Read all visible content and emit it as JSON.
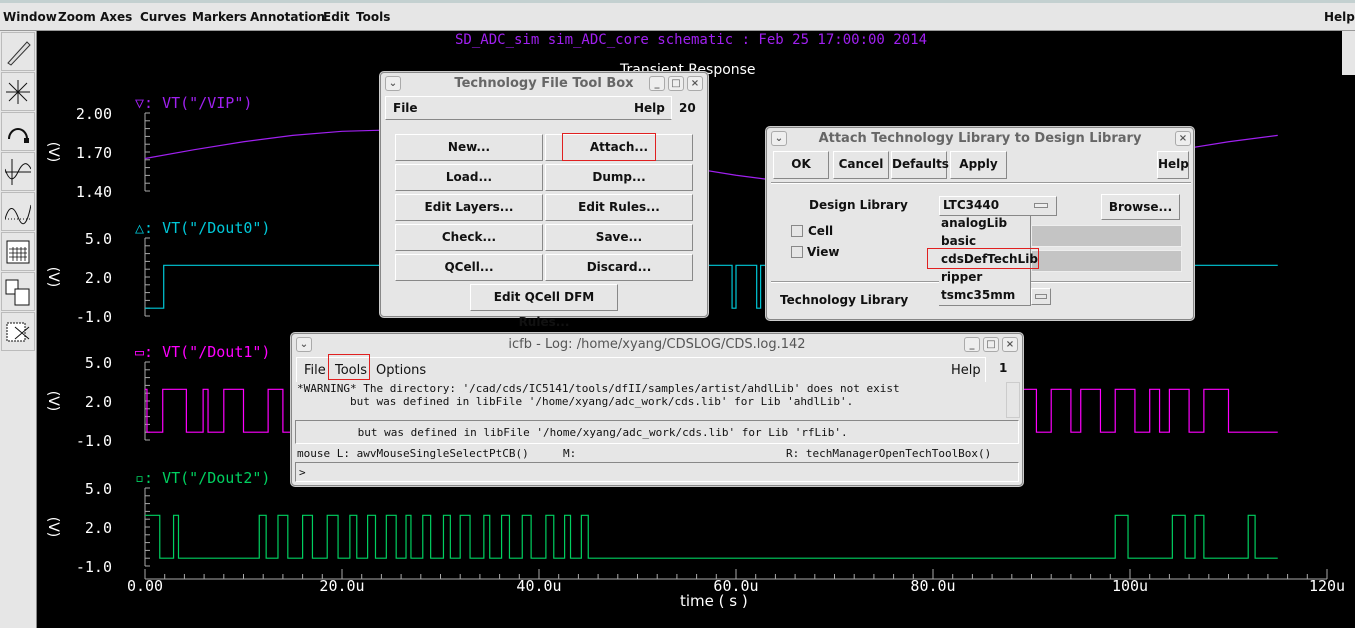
{
  "menubar": {
    "items": [
      "Window",
      "Zoom",
      "Axes",
      "Curves",
      "Markers",
      "Annotation",
      "Edit",
      "Tools"
    ],
    "help": "Help"
  },
  "toolbar": {
    "icons": [
      "pencil-icon",
      "zoom-fit-icon",
      "undo-arc-icon",
      "ab-marker-icon",
      "delta-marker-icon",
      "calculator-icon",
      "strip-icon",
      "cut-icon"
    ]
  },
  "plot": {
    "header": "SD_ADC_sim sim_ADC_core schematic : Feb 25 17:00:00 2014",
    "title": "Transient Response",
    "xlabel": "time ( s )",
    "ylabel": "(V)"
  },
  "chart_data": {
    "type": "line",
    "title": "Transient Response",
    "xlabel": "time ( s )",
    "xticks": [
      "0.00",
      "20.0u",
      "40.0u",
      "60.0u",
      "80.0u",
      "100u",
      "120u"
    ],
    "xlim": [
      0,
      120
    ],
    "strips": [
      {
        "name": "▽: VT(\"/VIP\")",
        "color": "#a020f0",
        "ylim": [
          1.4,
          2.0
        ],
        "yticks": [
          "2.00",
          "1.70",
          "1.40"
        ],
        "kind": "analog",
        "x": [
          0,
          5,
          10,
          15,
          20,
          25,
          30,
          35,
          40,
          45,
          50,
          55,
          60,
          65,
          70,
          75,
          80,
          85,
          90,
          95,
          100,
          105,
          110,
          115
        ],
        "y": [
          1.65,
          1.718,
          1.779,
          1.828,
          1.859,
          1.87,
          1.859,
          1.828,
          1.779,
          1.718,
          1.65,
          1.582,
          1.521,
          1.472,
          1.441,
          1.43,
          1.441,
          1.472,
          1.521,
          1.582,
          1.65,
          1.718,
          1.779,
          1.828
        ]
      },
      {
        "name": "△: VT(\"/Dout0\")",
        "color": "#00c8d8",
        "ylim": [
          -1,
          5
        ],
        "yticks": [
          "5.0",
          "2.0",
          "-1.0"
        ],
        "kind": "digital",
        "high": 2.9,
        "low": -0.4,
        "start": "low",
        "end": 115,
        "toggles": [
          1.9,
          59.6,
          60.0,
          62.1,
          62.5,
          64.8,
          65.2
        ]
      },
      {
        "name": "▭: VT(\"/Dout1\")",
        "color": "#ff00ff",
        "ylim": [
          -1,
          5
        ],
        "yticks": [
          "5.0",
          "2.0",
          "-1.0"
        ],
        "kind": "digital",
        "high": 2.9,
        "low": -0.4,
        "start": "high",
        "end": 115,
        "toggles": [
          0.2,
          1.8,
          4.2,
          5.9,
          6.4,
          8.0,
          10.0,
          12.5,
          14.0,
          16.0,
          17.5,
          19.5,
          21.0,
          24.0,
          25.5,
          28.0,
          29.0,
          31.0,
          33.0,
          36.0,
          37.5,
          40.0,
          42.0,
          44.0,
          46.0,
          49.0,
          51,
          53,
          55,
          58,
          60,
          62,
          64,
          67,
          69,
          71,
          73,
          76,
          78,
          80,
          82,
          85,
          87,
          89,
          90.5,
          92,
          94,
          95,
          97,
          98.5,
          100.5,
          102,
          103,
          104,
          106,
          107.5,
          110
        ]
      },
      {
        "name": "▫: VT(\"/Dout2\")",
        "color": "#00d060",
        "ylim": [
          -1,
          5
        ],
        "yticks": [
          "5.0",
          "2.0",
          "-1.0"
        ],
        "kind": "digital",
        "high": 2.9,
        "low": -0.4,
        "start": "high",
        "end": 115,
        "toggles": [
          1.5,
          2.9,
          3.4,
          11.6,
          12.3,
          13.5,
          14.5,
          16.0,
          17.0,
          18.5,
          19.6,
          20.8,
          21.5,
          22.6,
          23.4,
          24.5,
          25.5,
          26.5,
          27.0,
          28.2,
          29.0,
          30.3,
          31.0,
          32.0,
          33.0,
          34.4,
          35.0,
          36.2,
          37.0,
          38.3,
          39.2,
          40.7,
          41.5,
          42.6,
          43.2,
          44.3,
          45.0,
          98.5,
          99.8,
          104.3,
          105.6,
          106.6,
          107.5,
          112.0,
          112.7
        ]
      }
    ]
  },
  "techbox": {
    "title": "Technology File Tool Box",
    "menu_file": "File",
    "menu_help": "Help",
    "count": "20",
    "buttons": [
      "New...",
      "Attach...",
      "Load...",
      "Dump...",
      "Edit Layers...",
      "Edit Rules...",
      "Check...",
      "Save...",
      "QCell...",
      "Discard..."
    ],
    "dfm": "Edit QCell DFM Rules..."
  },
  "attach": {
    "title": "Attach Technology Library to Design Library",
    "ok": "OK",
    "cancel": "Cancel",
    "defaults": "Defaults",
    "apply": "Apply",
    "help": "Help",
    "design_library_label": "Design Library",
    "design_library_value": "LTC3440",
    "browse": "Browse...",
    "cell": "Cell",
    "view": "View",
    "options": [
      "analogLib",
      "basic",
      "cdsDefTechLib",
      "ripper",
      "tsmc35mm"
    ],
    "tech_library_label": "Technology Library"
  },
  "log": {
    "title": "icfb - Log: /home/xyang/CDSLOG/CDS.log.142",
    "menu": [
      "File",
      "Tools",
      "Options"
    ],
    "help": "Help",
    "count": "1",
    "lines": [
      "*WARNING* The directory: '/cad/cds/IC5141/tools/dfII/samples/artist/ahdlLib' does not exist",
      "        but was defined in libFile '/home/xyang/adc_work/cds.lib' for Lib 'ahdlLib'."
    ],
    "current": "         but was defined in libFile '/home/xyang/adc_work/cds.lib' for Lib 'rfLib'.",
    "mouse_l": "mouse L: awvMouseSingleSelectPtCB()",
    "mouse_m": "M:",
    "mouse_r": "R: techManagerOpenTechToolBox()",
    "prompt": ">"
  }
}
